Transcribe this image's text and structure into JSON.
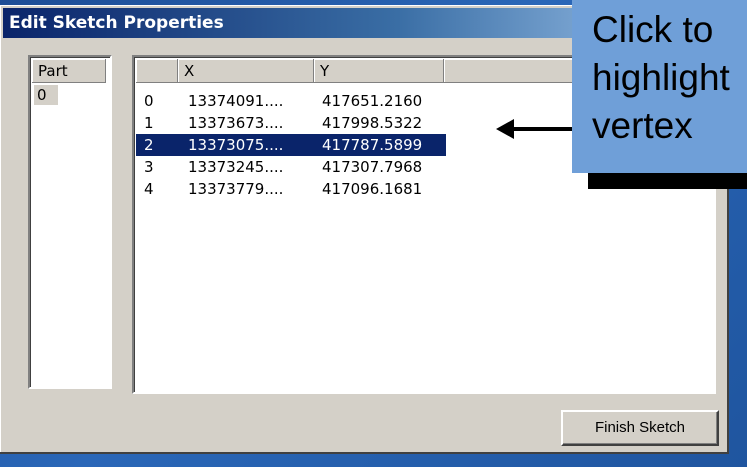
{
  "window": {
    "title": "Edit Sketch Properties"
  },
  "part_list": {
    "header": "Part",
    "items": [
      "0"
    ]
  },
  "vertex_list": {
    "headers": {
      "index": "",
      "x": "X",
      "y": "Y"
    },
    "rows": [
      {
        "index": "0",
        "x": "13374091....",
        "y": "417651.2160",
        "selected": false
      },
      {
        "index": "1",
        "x": "13373673....",
        "y": "417998.5322",
        "selected": false
      },
      {
        "index": "2",
        "x": "13373075....",
        "y": "417787.5899",
        "selected": true
      },
      {
        "index": "3",
        "x": "13373245....",
        "y": "417307.7968",
        "selected": false
      },
      {
        "index": "4",
        "x": "13373779....",
        "y": "417096.1681",
        "selected": false
      }
    ]
  },
  "buttons": {
    "finish_sketch": "Finish Sketch"
  },
  "callout": {
    "text": "Click to\nhighlight\nvertex"
  },
  "colors": {
    "selection": "#0a246a",
    "callout": "#6f9fd8",
    "background": "#2a67b8"
  }
}
